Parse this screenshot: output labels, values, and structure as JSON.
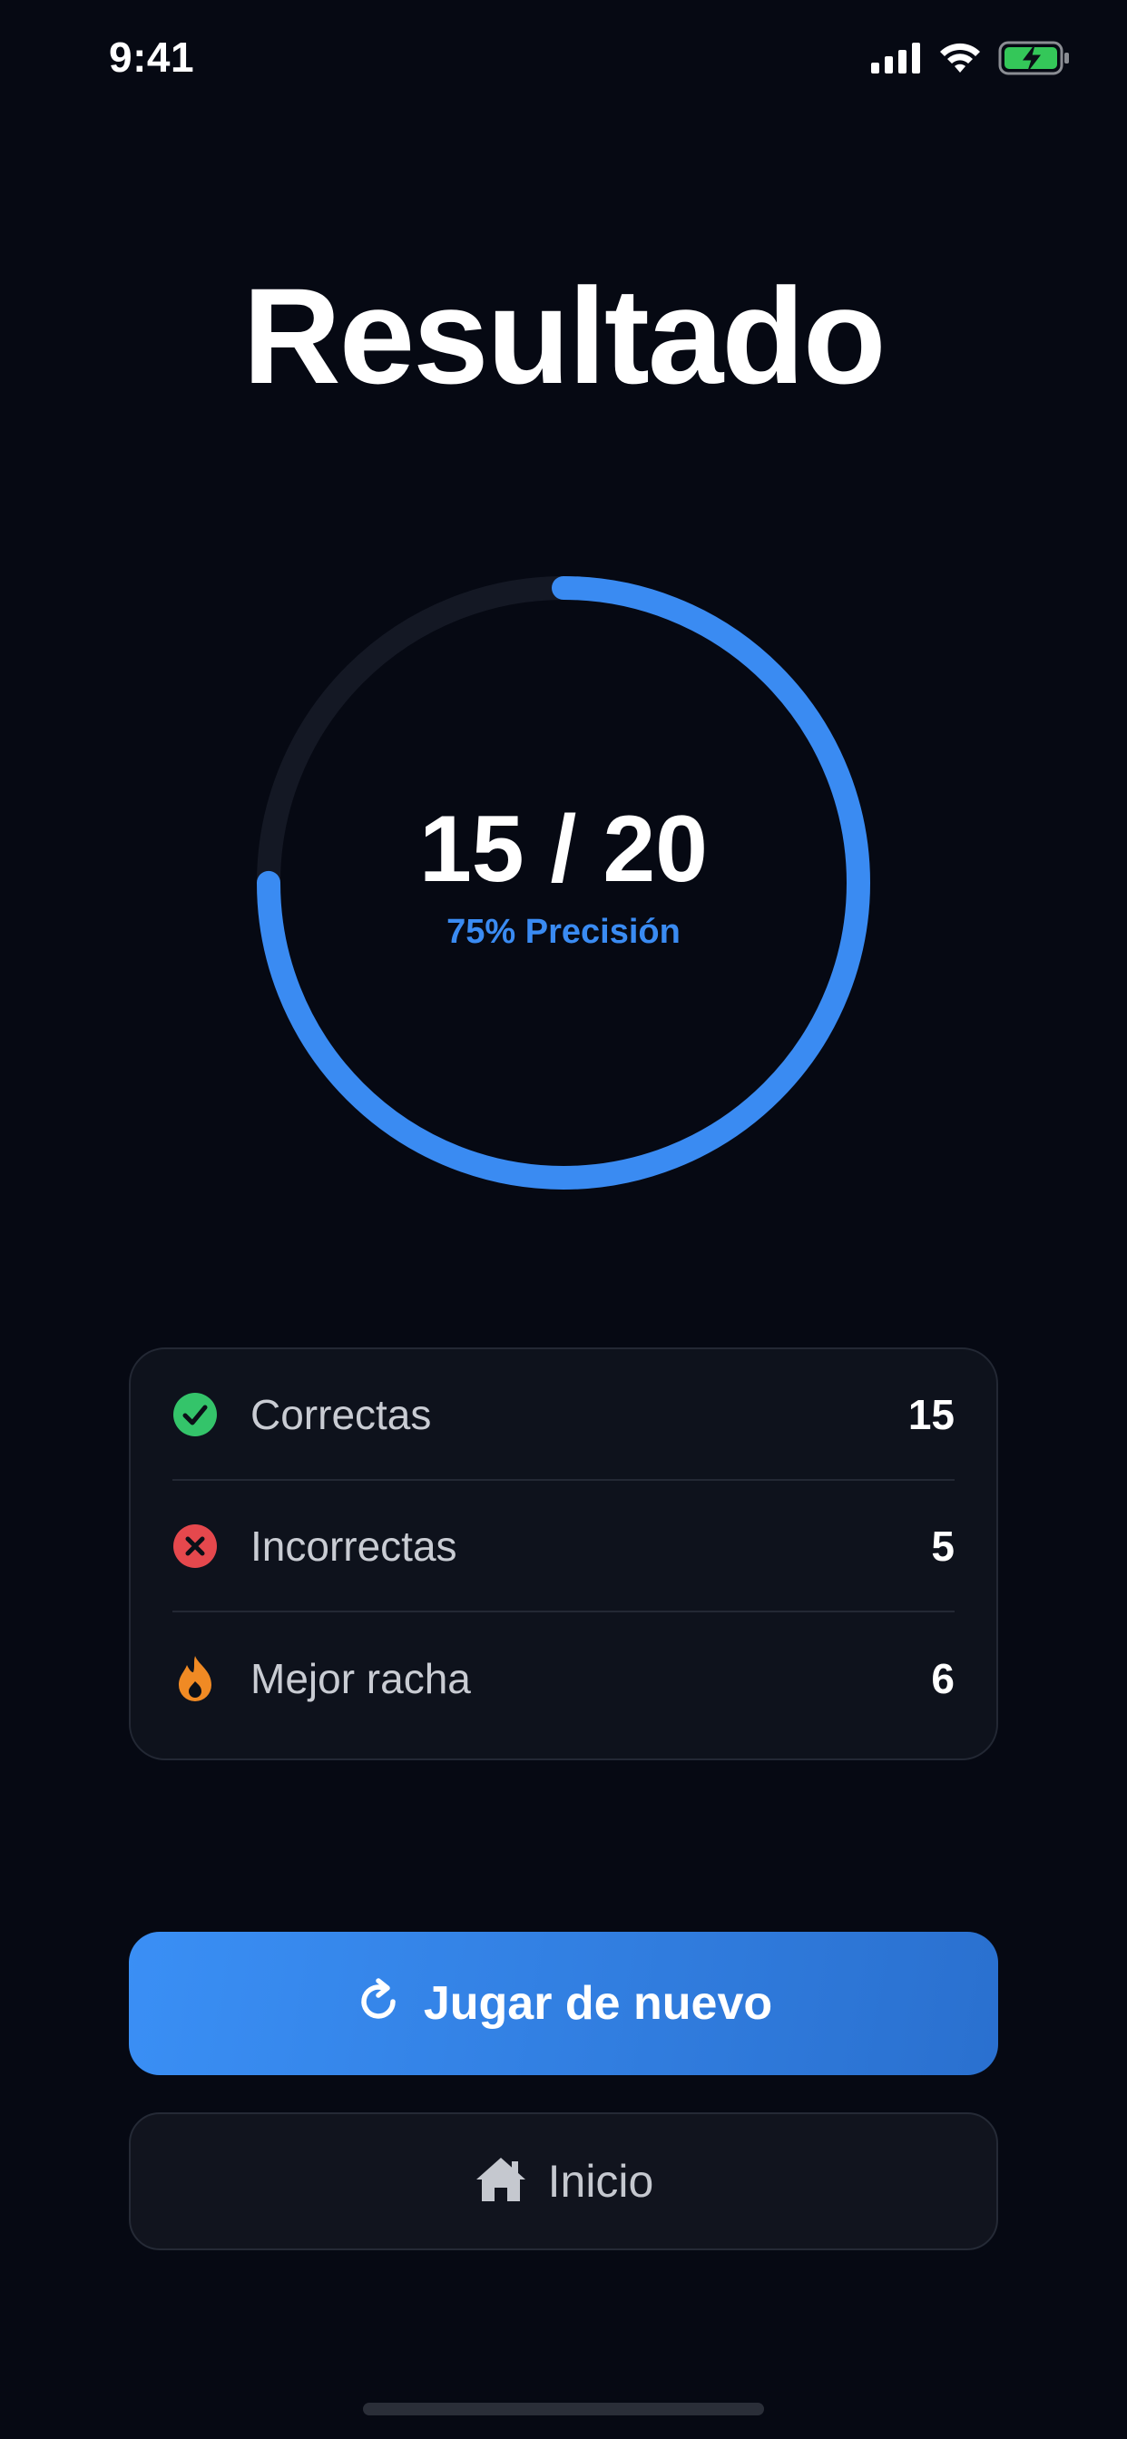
{
  "status_bar": {
    "time": "9:41",
    "icons": [
      "signal-icon",
      "wifi-icon",
      "battery-charging-icon"
    ]
  },
  "title": "Resultado",
  "score": {
    "text": "15 / 20",
    "correct": 15,
    "total": 20,
    "accuracy_label": "75% Precisión",
    "accuracy_fraction": 0.75
  },
  "stats": [
    {
      "icon": "check-circle-icon",
      "label": "Correctas",
      "value": "15",
      "color": "#34c46a"
    },
    {
      "icon": "x-circle-icon",
      "label": "Incorrectas",
      "value": "5",
      "color": "#e5484d"
    },
    {
      "icon": "flame-icon",
      "label": "Mejor racha",
      "value": "6",
      "color": "#f08a24"
    }
  ],
  "buttons": {
    "play_again": {
      "label": "Jugar de nuevo",
      "icon": "refresh-icon"
    },
    "home": {
      "label": "Inicio",
      "icon": "home-icon"
    }
  },
  "colors": {
    "accent": "#3a8bf2",
    "background": "#060913",
    "track": "#141824"
  }
}
